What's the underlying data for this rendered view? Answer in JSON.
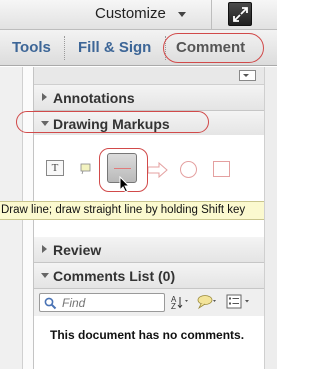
{
  "topbar": {
    "customize_label": "Customize"
  },
  "tabs": {
    "tools": "Tools",
    "fill_sign": "Fill & Sign",
    "comment": "Comment"
  },
  "sections": {
    "annotations": "Annotations",
    "drawing_markups": "Drawing Markups",
    "review": "Review",
    "comments_list": "Comments List (0)"
  },
  "drawing_tools": [
    "text-box-tool-icon",
    "callout-tool-icon",
    "line-tool-icon",
    "arrow-tool-icon",
    "oval-tool-icon",
    "rectangle-tool-icon"
  ],
  "tooltip": {
    "text": "Draw line; draw straight line by holding Shift key"
  },
  "comments": {
    "search_placeholder": "Find",
    "empty_message": "This document has no comments."
  },
  "colors": {
    "tab_blue": "#3d6697",
    "highlight_red": "#d14a4a",
    "tooltip_bg": "#fbf9cf"
  }
}
